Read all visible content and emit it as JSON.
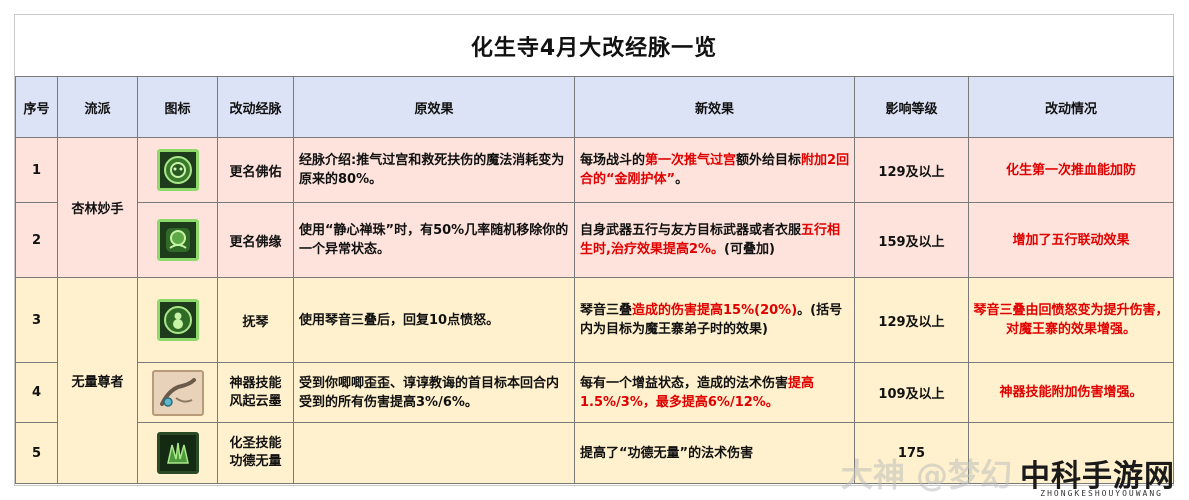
{
  "title": "化生寺4月大改经脉一览",
  "headers": [
    "序号",
    "流派",
    "图标",
    "改动经脉",
    "原效果",
    "新效果",
    "影响等级",
    "改动情况"
  ],
  "groups": [
    "杏林妙手",
    "无量尊者"
  ],
  "rows": [
    {
      "no": "1",
      "icon": "green-face-icon",
      "name": "更名佛佑",
      "original": "经脉介绍:推气过宫和救死扶伤的魔法消耗变为原来的80%。",
      "new_parts": [
        "每场战斗的",
        "第一次推气过宫",
        "额外给目标",
        "附加2回合的“金刚护体”",
        "。"
      ],
      "level": "129及以上",
      "change": "化生第一次推血能加防"
    },
    {
      "no": "2",
      "icon": "green-lotus-icon",
      "name": "更名佛缘",
      "original": "使用“静心禅珠”时，有50%几率随机移除你的一个异常状态。",
      "new_parts": [
        "自身武器五行与友方目标武器或者衣服",
        "五行相生时,治疗效果提高2%。",
        "(可叠加)"
      ],
      "level": "159及以上",
      "change": "增加了五行联动效果"
    },
    {
      "no": "3",
      "icon": "green-gourd-icon",
      "name": "抚琴",
      "original": "使用琴音三叠后，回复10点愤怒。",
      "new_parts": [
        "琴音三叠",
        "造成的伤害提高15%(20%)",
        "。(括号内为目标为魔王寨弟子时的效果)"
      ],
      "level": "129及以上",
      "change": "琴音三叠由回愤怒变为提升伤害，对魔王寨的效果增强。"
    },
    {
      "no": "4",
      "icon": "artifact-hand-icon",
      "name": "神器技能风起云墨",
      "name_lines": [
        "神器技能",
        "风起云墨"
      ],
      "original": "受到你唧唧歪歪、谆谆教诲的首目标本回合内受到的所有伤害提高3%/6%。",
      "new_parts": [
        "每有一个增益状态，造成的法术伤害",
        "提高1.5%/3%，最多提高6%/12%。"
      ],
      "level": "109及以上",
      "change": "神器技能附加伤害增强。"
    },
    {
      "no": "5",
      "icon": "green-claw-icon",
      "name": "化圣技能功德无量",
      "name_lines": [
        "化圣技能",
        "功德无量"
      ],
      "original": "",
      "new_parts": [
        "提高了“功德无量”的法术伤害"
      ],
      "level": "175",
      "change": ""
    }
  ],
  "watermark": {
    "left": "大神 @梦幻",
    "logo": "中科手游网",
    "sub": "ZHONGKESHOUYOUWANG"
  }
}
